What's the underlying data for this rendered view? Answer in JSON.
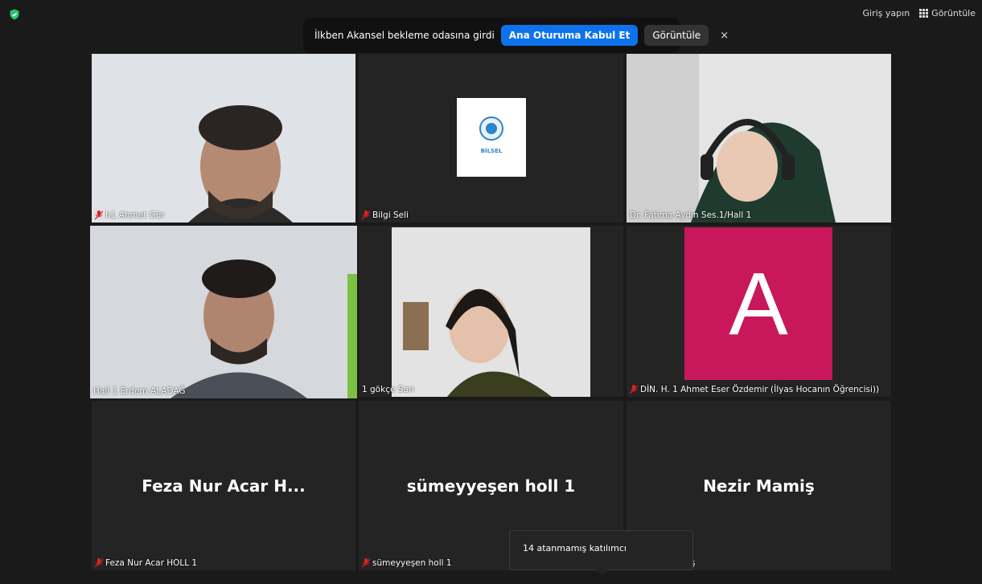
{
  "topbar": {
    "signin_label": "Giriş yapın",
    "view_label": "Görüntüle"
  },
  "notification": {
    "message": "İlkben Akansel bekleme odasına girdi",
    "admit_label": "Ana Oturuma Kabul Et",
    "view_label": "Görüntüle",
    "close_label": "×"
  },
  "tiles": {
    "t1": {
      "label": "h1 Ahmet Gür",
      "muted": true
    },
    "t2": {
      "label": "Bilgi Seli",
      "muted": true,
      "logo_text": "BİLSEL"
    },
    "t3": {
      "label": "Dr. Fatıma Aydın Ses.1/Hall 1",
      "muted": false
    },
    "t4": {
      "label": "Hall 1 Erdem ALADAĞ",
      "muted": false,
      "active_speaker": true
    },
    "t5": {
      "label": "1 gökçe Sarı",
      "muted": false
    },
    "t6": {
      "label": "DİN. H. 1 Ahmet Eser Özdemir (İlyas Hocanın Öğrencisi))",
      "muted": true,
      "avatar_letter": "A"
    },
    "t7": {
      "center_name": "Feza Nur Acar H...",
      "label": "Feza Nur Acar HOLL 1",
      "muted": true
    },
    "t8": {
      "center_name": "sümeyyeşen holl 1",
      "label": "sümeyyeşen holl 1",
      "muted": true
    },
    "t9": {
      "center_name": "Nezir Mamiş",
      "label": "ş",
      "muted": false
    }
  },
  "popup": {
    "text": "14 atanmamış katılımcı"
  },
  "colors": {
    "accent": "#0e72ed",
    "active_border": "#d8e27a",
    "avatar_bg": "#c8175a",
    "mute_red": "#e02020",
    "shield": "#27c26b"
  }
}
